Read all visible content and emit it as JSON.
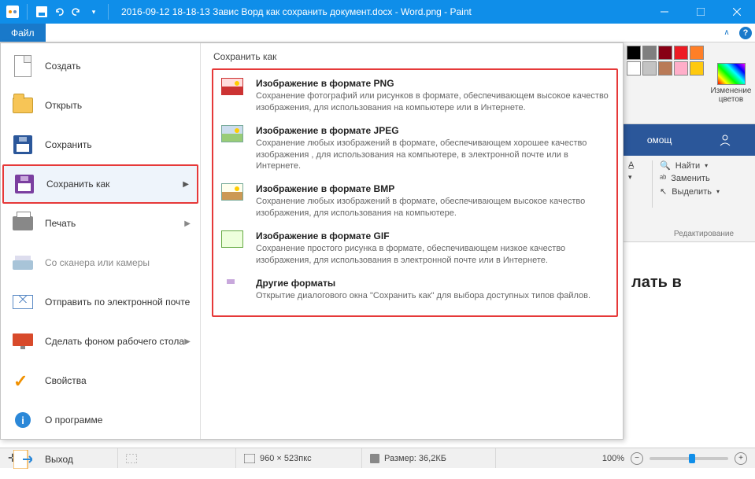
{
  "titlebar": {
    "title": "2016-09-12 18-18-13 Завис Ворд как сохранить документ.docx - Word.png - Paint"
  },
  "menu": {
    "file": "Файл"
  },
  "file_menu": {
    "items": [
      {
        "label": "Создать"
      },
      {
        "label": "Открыть"
      },
      {
        "label": "Сохранить"
      },
      {
        "label": "Сохранить как"
      },
      {
        "label": "Печать"
      },
      {
        "label": "Со сканера или камеры"
      },
      {
        "label": "Отправить по электронной почте"
      },
      {
        "label": "Сделать фоном рабочего стола"
      },
      {
        "label": "Свойства"
      },
      {
        "label": "О программе"
      },
      {
        "label": "Выход"
      }
    ]
  },
  "save_as": {
    "title": "Сохранить как",
    "formats": [
      {
        "title": "Изображение в формате PNG",
        "desc": "Сохранение фотографий или рисунков в формате, обеспечивающем высокое качество изображения, для использования на компьютере или в Интернете."
      },
      {
        "title": "Изображение в формате JPEG",
        "desc": "Сохранение любых изображений в формате, обеспечивающем хорошее качество изображения , для использования на компьютере, в электронной почте или в Интернете."
      },
      {
        "title": "Изображение в формате BMP",
        "desc": "Сохранение любых изображений в формате, обеспечивающем высокое качество изображения, для использования на компьютере."
      },
      {
        "title": "Изображение в формате GIF",
        "desc": "Сохранение простого рисунка в формате, обеспечивающем низкое качество изображения, для использования в электронной почте или в Интернете."
      },
      {
        "title": "Другие форматы",
        "desc": "Открытие диалогового окна \"Сохранить как\" для выбора доступных типов файлов."
      }
    ]
  },
  "ribbon_right": {
    "editcolors": "Изменение цветов",
    "colors_row1": [
      "#000000",
      "#7f7f7f",
      "#880015",
      "#ed1c24",
      "#ff7f27",
      "#fff200"
    ],
    "colors_row2": [
      "#ffffff",
      "#c3c3c3",
      "#b97a57",
      "#ffaec9",
      "#ffc90e",
      "#efe4b0"
    ]
  },
  "word_bg": {
    "tab": "омощ",
    "find": "Найти",
    "replace": "Заменить",
    "select": "Выделить",
    "group": "Редактирование",
    "doc_text": "лать в"
  },
  "statusbar": {
    "cross": "✛",
    "dims": "960 × 523пкс",
    "size_label": "Размер: 36,2КБ",
    "zoom": "100%"
  }
}
